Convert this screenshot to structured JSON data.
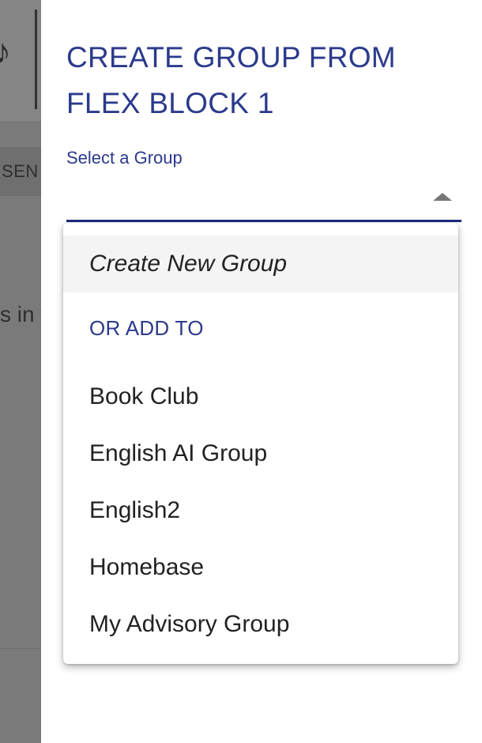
{
  "background": {
    "tab_label": "SEN",
    "body_text": "s in t"
  },
  "panel": {
    "title": "CREATE GROUP FROM FLEX BLOCK 1",
    "select_label": "Select a Group",
    "select_value": ""
  },
  "menu": {
    "create_option": "Create New Group",
    "subheader": "OR ADD TO",
    "groups": [
      "Book Club",
      "English AI Group",
      "English2",
      "Homebase",
      "My Advisory Group"
    ]
  },
  "colors": {
    "accent": "#2b3a8c",
    "overlay": "#7d7d7d"
  }
}
